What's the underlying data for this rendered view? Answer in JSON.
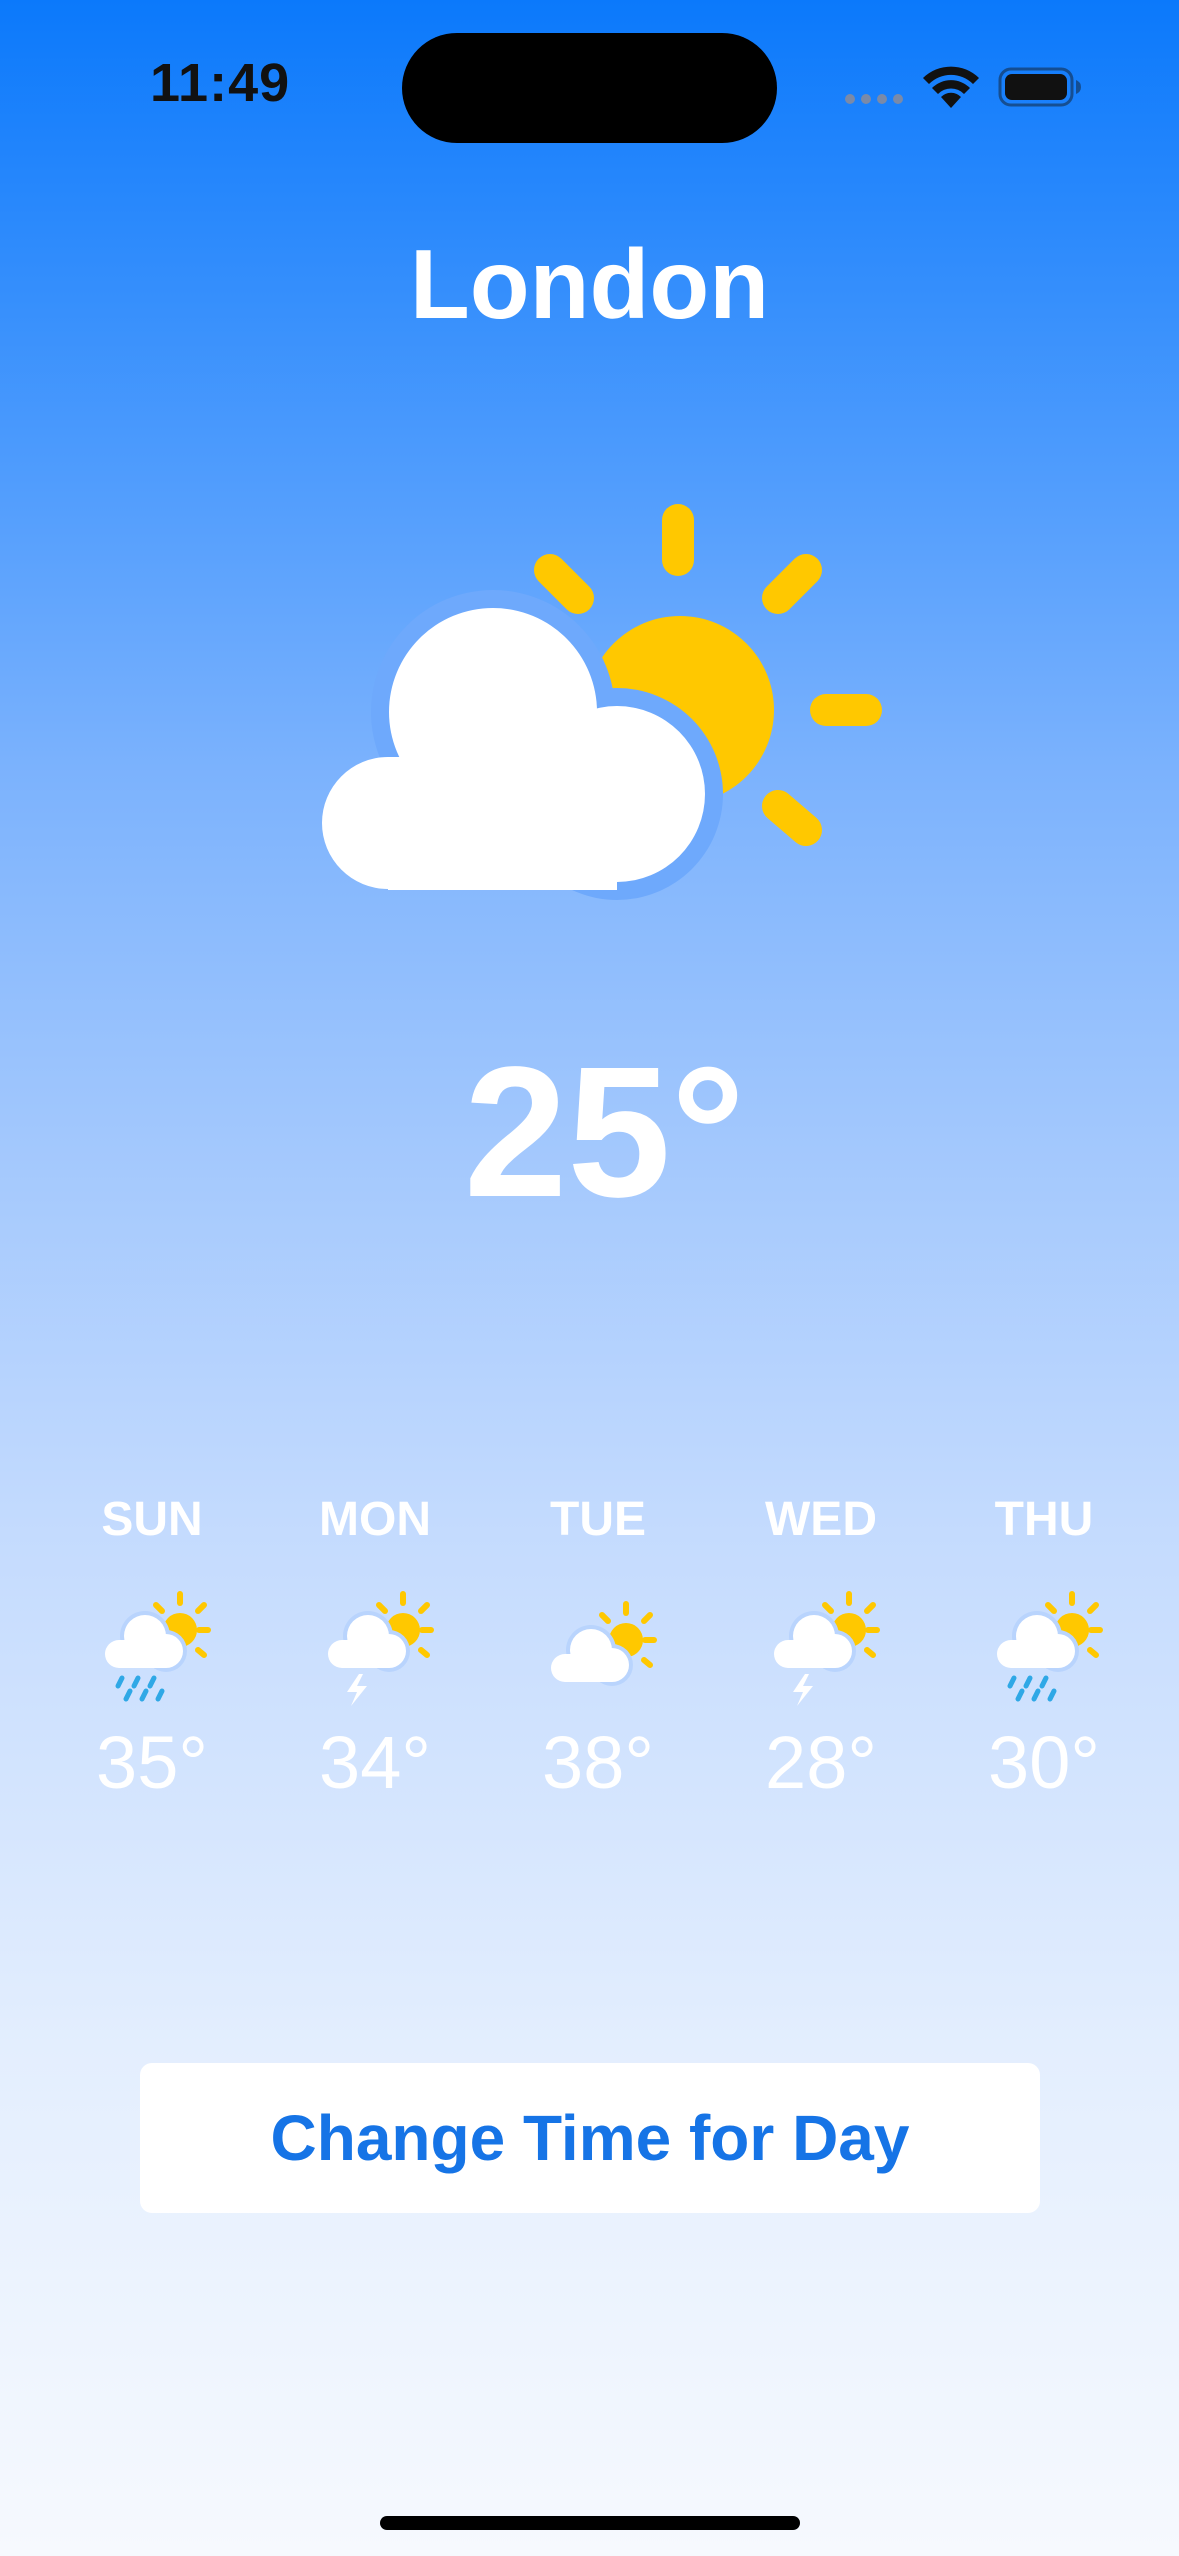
{
  "status_bar": {
    "time": "11:49"
  },
  "city": "London",
  "current": {
    "temperature": "25°",
    "condition_icon": "cloud-sun-icon"
  },
  "forecast": [
    {
      "day": "SUN",
      "temp": "35°",
      "icon": "cloud-sun-rain-icon"
    },
    {
      "day": "MON",
      "temp": "34°",
      "icon": "cloud-sun-bolt-icon"
    },
    {
      "day": "TUE",
      "temp": "38°",
      "icon": "cloud-sun-icon"
    },
    {
      "day": "WED",
      "temp": "28°",
      "icon": "cloud-sun-bolt-icon"
    },
    {
      "day": "THU",
      "temp": "30°",
      "icon": "cloud-sun-rain-icon"
    }
  ],
  "button": {
    "label": "Change Time for Day"
  },
  "colors": {
    "sun": "#ffc800",
    "rain": "#2fa8e6",
    "button_text": "#1674e6",
    "gradient_top": "#0b79fb",
    "gradient_bottom": "#f6f9fe"
  }
}
